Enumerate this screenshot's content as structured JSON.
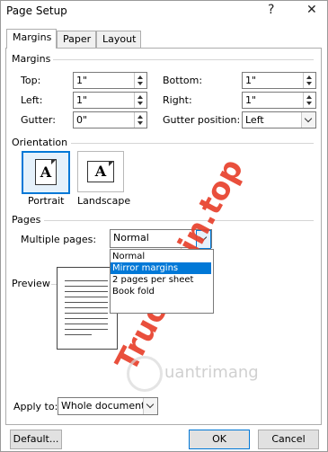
{
  "window": {
    "title": "Page Setup",
    "help_glyph": "?",
    "close_glyph": "✕"
  },
  "tabs": [
    {
      "label": "Margins",
      "active": true
    },
    {
      "label": "Paper",
      "active": false
    },
    {
      "label": "Layout",
      "active": false
    }
  ],
  "margins": {
    "group_label": "Margins",
    "top": {
      "label": "Top:",
      "value": "1\""
    },
    "bottom": {
      "label": "Bottom:",
      "value": "1\""
    },
    "left": {
      "label": "Left:",
      "value": "1\""
    },
    "right": {
      "label": "Right:",
      "value": "1\""
    },
    "gutter": {
      "label": "Gutter:",
      "value": "0\""
    },
    "gutter_position": {
      "label": "Gutter position:",
      "value": "Left"
    }
  },
  "orientation": {
    "group_label": "Orientation",
    "portrait_label": "Portrait",
    "landscape_label": "Landscape",
    "icon_letter": "A",
    "selected": "Portrait"
  },
  "pages": {
    "group_label": "Pages",
    "multiple_pages_label": "Multiple pages:",
    "multiple_pages_value": "Normal",
    "options": [
      "Normal",
      "Mirror margins",
      "2 pages per sheet",
      "Book fold"
    ],
    "highlighted_option": "Mirror margins"
  },
  "preview": {
    "group_label": "Preview"
  },
  "apply_to": {
    "label": "Apply to:",
    "value": "Whole document"
  },
  "buttons": {
    "default": "Default...",
    "ok": "OK",
    "cancel": "Cancel"
  },
  "watermark": {
    "text": "Truongtin.top",
    "subtext": "uantrimang",
    "accent_color": "#e8412c"
  },
  "colors": {
    "accent": "#0078d7",
    "selection": "#0078d7"
  }
}
